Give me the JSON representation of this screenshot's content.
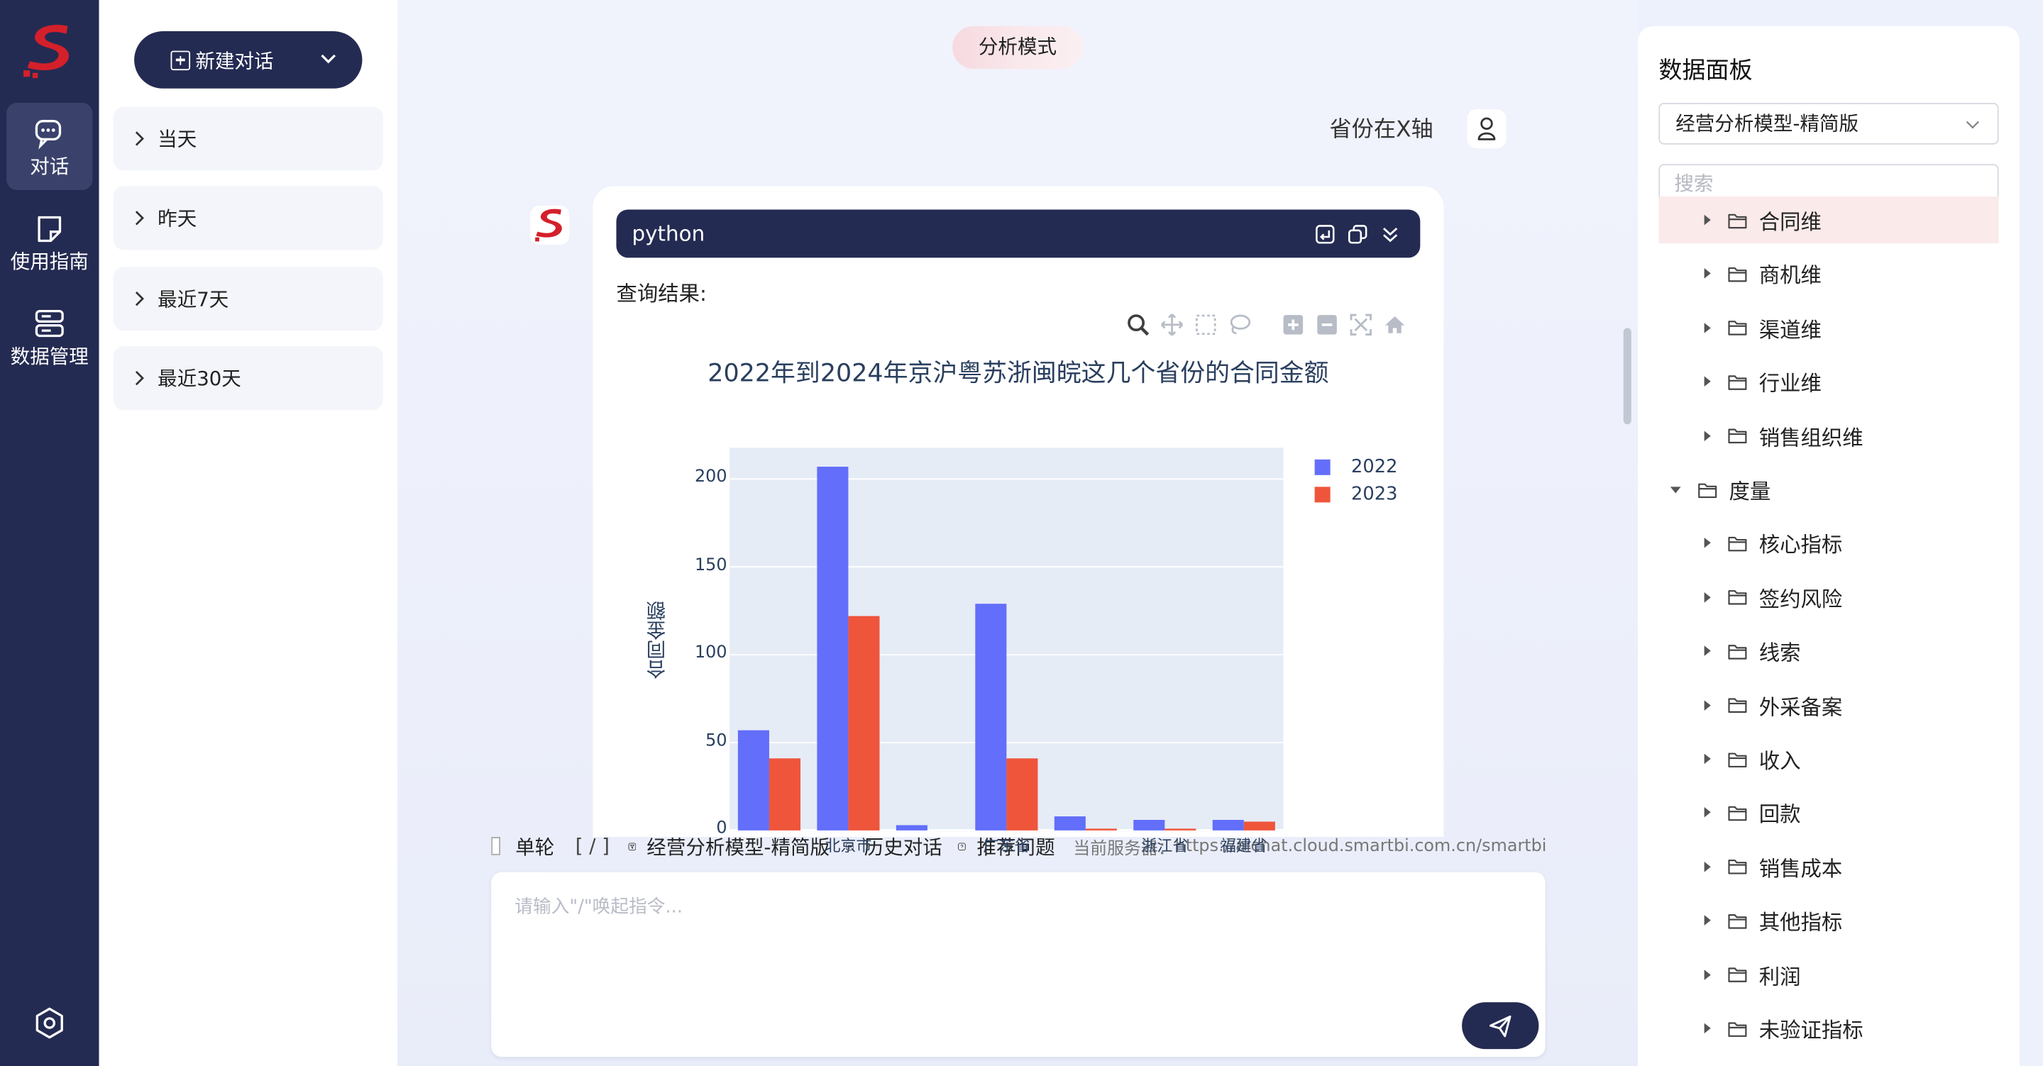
{
  "rail": {
    "items": [
      {
        "label": "对话",
        "icon": "chat-icon"
      },
      {
        "label": "使用指南",
        "icon": "guide-icon"
      },
      {
        "label": "数据管理",
        "icon": "database-icon"
      }
    ],
    "settings_icon": "settings-icon"
  },
  "history": {
    "new_chat_label": "新建对话",
    "groups": [
      {
        "label": "当天"
      },
      {
        "label": "昨天"
      },
      {
        "label": "最近7天"
      },
      {
        "label": "最近30天"
      }
    ]
  },
  "conversation": {
    "mode_label": "分析模式",
    "user_message": "省份在X轴",
    "code_block": {
      "language": "python"
    },
    "result_label": "查询结果:"
  },
  "chart_data": {
    "type": "bar",
    "title": "2022年到2024年京沪粤苏浙闽皖这几个省份的合同金额",
    "ylabel": "合同金额",
    "ylim": [
      0,
      215
    ],
    "yticks": [
      "0",
      "50",
      "100",
      "150",
      "200"
    ],
    "legend_position": "top-right",
    "categories": [
      "",
      "北京市",
      "",
      "广东省",
      "",
      "浙江省",
      "福建省"
    ],
    "series": [
      {
        "name": "2022",
        "color": "#636efa",
        "values": [
          57,
          207,
          3,
          129,
          8,
          6,
          6
        ]
      },
      {
        "name": "2023",
        "color": "#ef553b",
        "values": [
          41,
          122,
          0,
          41,
          1,
          1,
          5
        ]
      }
    ],
    "grid": true
  },
  "input": {
    "single_turn_label": "单轮",
    "slash_hint": "[ / ]",
    "model_label": "经营分析模型-精简版",
    "history_label": "历史对话",
    "recommend_label": "推荐问题",
    "server_label": "当前服务器：",
    "server_url": "https://aichat.cloud.smartbi.com.cn/smartbi",
    "placeholder": "请输入\"/\"唤起指令..."
  },
  "data_panel": {
    "title": "数据面板",
    "model_selected": "经营分析模型-精简版",
    "search_placeholder": "搜索",
    "tree": [
      {
        "label": "合同维",
        "level": 2,
        "expanded": false,
        "selected": true
      },
      {
        "label": "商机维",
        "level": 2,
        "expanded": false
      },
      {
        "label": "渠道维",
        "level": 2,
        "expanded": false
      },
      {
        "label": "行业维",
        "level": 2,
        "expanded": false
      },
      {
        "label": "销售组织维",
        "level": 2,
        "expanded": false
      },
      {
        "label": "度量",
        "level": 1,
        "expanded": true
      },
      {
        "label": "核心指标",
        "level": 2,
        "expanded": false
      },
      {
        "label": "签约风险",
        "level": 2,
        "expanded": false
      },
      {
        "label": "线索",
        "level": 2,
        "expanded": false
      },
      {
        "label": "外采备案",
        "level": 2,
        "expanded": false
      },
      {
        "label": "收入",
        "level": 2,
        "expanded": false
      },
      {
        "label": "回款",
        "level": 2,
        "expanded": false
      },
      {
        "label": "销售成本",
        "level": 2,
        "expanded": false
      },
      {
        "label": "其他指标",
        "level": 2,
        "expanded": false
      },
      {
        "label": "利润",
        "level": 2,
        "expanded": false
      },
      {
        "label": "未验证指标",
        "level": 2,
        "expanded": false
      }
    ]
  }
}
